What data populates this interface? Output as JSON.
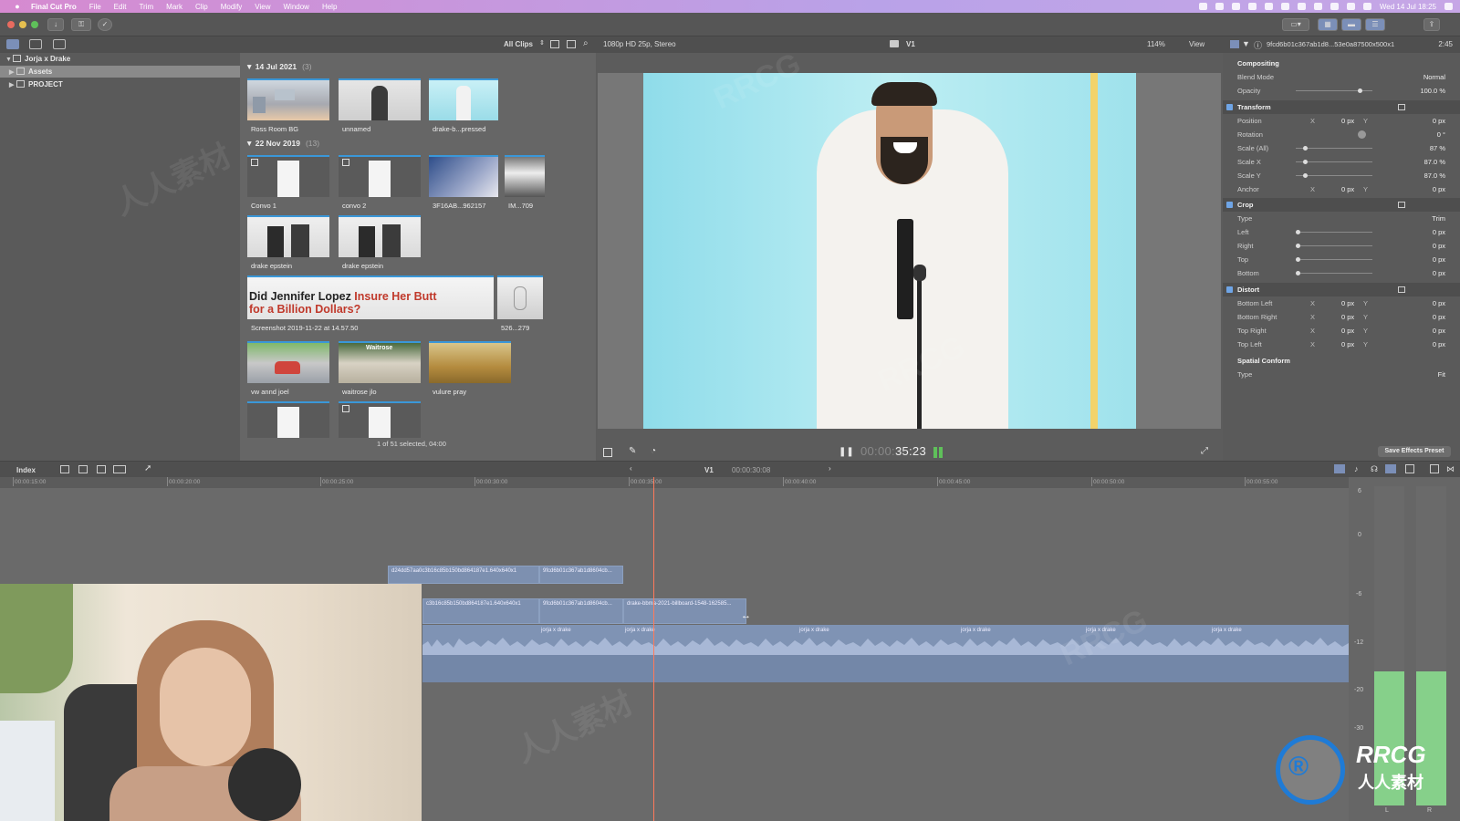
{
  "menubar": {
    "app": "Final Cut Pro",
    "items": [
      "File",
      "Edit",
      "Trim",
      "Mark",
      "Clip",
      "Modify",
      "View",
      "Window",
      "Help"
    ],
    "datetime": "Wed 14 Jul 18:25"
  },
  "browser_header": {
    "filter": "All Clips",
    "format": "1080p HD 25p, Stereo"
  },
  "viewer_header": {
    "role": "V1",
    "zoom": "114%",
    "view": "View"
  },
  "inspector_header": {
    "clip_name": "9fcd6b01c367ab1d8...53e0a87500x500x1",
    "duration": "2:45"
  },
  "sidebar": {
    "library": "Jorja x Drake",
    "items": [
      "Assets",
      "PROJECT"
    ]
  },
  "browser": {
    "groups": [
      {
        "date": "14 Jul 2021",
        "count": "(3)"
      },
      {
        "date": "22 Nov 2019",
        "count": "(13)"
      }
    ],
    "clips": [
      "Ross Room BG",
      "unnamed",
      "drake-b...pressed",
      "Convo 1",
      "convo 2",
      "3F16AB...962157",
      "IM...709",
      "drake epstein",
      "drake epstein",
      "Screenshot 2019-11-22 at 14.57.50",
      "526...279",
      "vw annd joel",
      "waitrose jlo",
      "vulure pray"
    ],
    "headline_line1_a": "Did Jennifer Lopez ",
    "headline_line1_b": "Insure Her Butt",
    "headline_line2": "for a Billion Dollars?",
    "waitrose_sign": "Waitrose",
    "selection_info": "1 of 51 selected, 04:00"
  },
  "viewer": {
    "timecode_dim": "00:00:",
    "timecode": "35:23"
  },
  "inspector": {
    "compositing": {
      "title": "Compositing",
      "blend_mode_label": "Blend Mode",
      "blend_mode": "Normal",
      "opacity_label": "Opacity",
      "opacity": "100.0",
      "opacity_unit": "%"
    },
    "transform": {
      "title": "Transform",
      "position_label": "Position",
      "position_x": "0",
      "position_y": "0",
      "rotation_label": "Rotation",
      "rotation": "0",
      "rotation_unit": "°",
      "scale_all_label": "Scale (All)",
      "scale_all": "87",
      "scale_x_label": "Scale X",
      "scale_x": "87.0",
      "scale_y_label": "Scale Y",
      "scale_y": "87.0",
      "anchor_label": "Anchor",
      "anchor_x": "0",
      "anchor_y": "0"
    },
    "crop": {
      "title": "Crop",
      "type_label": "Type",
      "type": "Trim",
      "left_label": "Left",
      "right_label": "Right",
      "top_label": "Top",
      "bottom_label": "Bottom",
      "value": "0"
    },
    "distort": {
      "title": "Distort",
      "bl_label": "Bottom Left",
      "br_label": "Bottom Right",
      "tr_label": "Top Right",
      "tl_label": "Top Left",
      "value": "0"
    },
    "spatial": {
      "title": "Spatial Conform",
      "type_label": "Type",
      "type": "Fit"
    },
    "units": {
      "px": "px",
      "pct": "%",
      "x": "X",
      "y": "Y"
    },
    "save_preset": "Save Effects Preset"
  },
  "timeline": {
    "index": "Index",
    "role": "V1",
    "timecode": "00:00:30:08",
    "ruler": [
      "00:00:15:00",
      "00:00:20:00",
      "00:00:25:00",
      "00:00:30:00",
      "00:00:35:00",
      "00:00:40:00",
      "00:00:45:00",
      "00:00:50:00",
      "00:00:55:00"
    ],
    "clips": {
      "top_a": "d24dd57aa0c3b16c85b150bd864187e1.640x640x1",
      "top_b": "9fcd6b01c367ab1d8604cb...",
      "mid_a": "c3b16c85b150bd864187e1.640x640x1",
      "mid_b": "9fcd6b01c367ab1d8604cb...",
      "mid_c": "drake-bbma-2021-billboard-1548-162585..."
    },
    "audio_marker": "jorja x drake"
  },
  "meters": {
    "scale": [
      "6",
      "0",
      "-6",
      "-12",
      "-20",
      "-30"
    ],
    "left": "L",
    "right": "R",
    "left_level": 0.42,
    "right_level": 0.42
  },
  "watermark": {
    "brand": "RRCG",
    "cn": "人人素材"
  },
  "colors": {
    "accent": "#3a97d8",
    "playhead": "#ff7a5a",
    "meter": "#86d08a"
  }
}
